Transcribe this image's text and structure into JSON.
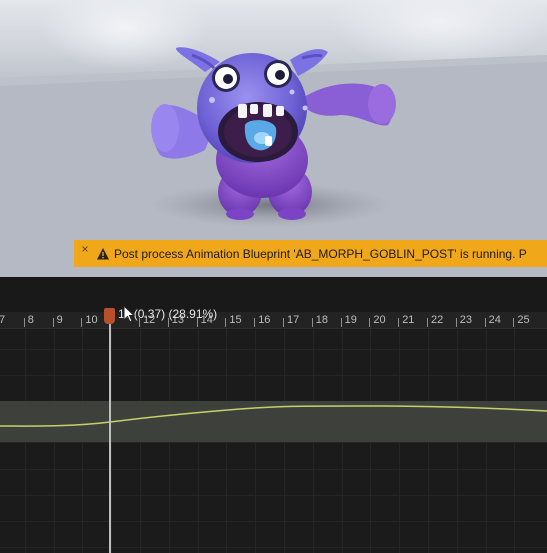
{
  "warning": {
    "close_glyph": "×",
    "icon": "warning-triangle-icon",
    "text": "Post process Animation Blueprint 'AB_MORPH_GOBLIN_POST' is running. P"
  },
  "timeline": {
    "frame_labels": [
      "7",
      "8",
      "9",
      "10",
      "11",
      "12",
      "13",
      "14",
      "15",
      "16",
      "17",
      "18",
      "19",
      "20",
      "21",
      "22",
      "23",
      "24",
      "25"
    ],
    "playhead_label": "11 (0.37) (28.91%)",
    "playhead_frame": 11,
    "curve_color": "#c8cf6a",
    "playhead_color": "#b7502b"
  },
  "colors": {
    "warning_bg": "#f0a81a",
    "monster_body": "#7b6ee0",
    "monster_legs": "#8a4fc9"
  }
}
